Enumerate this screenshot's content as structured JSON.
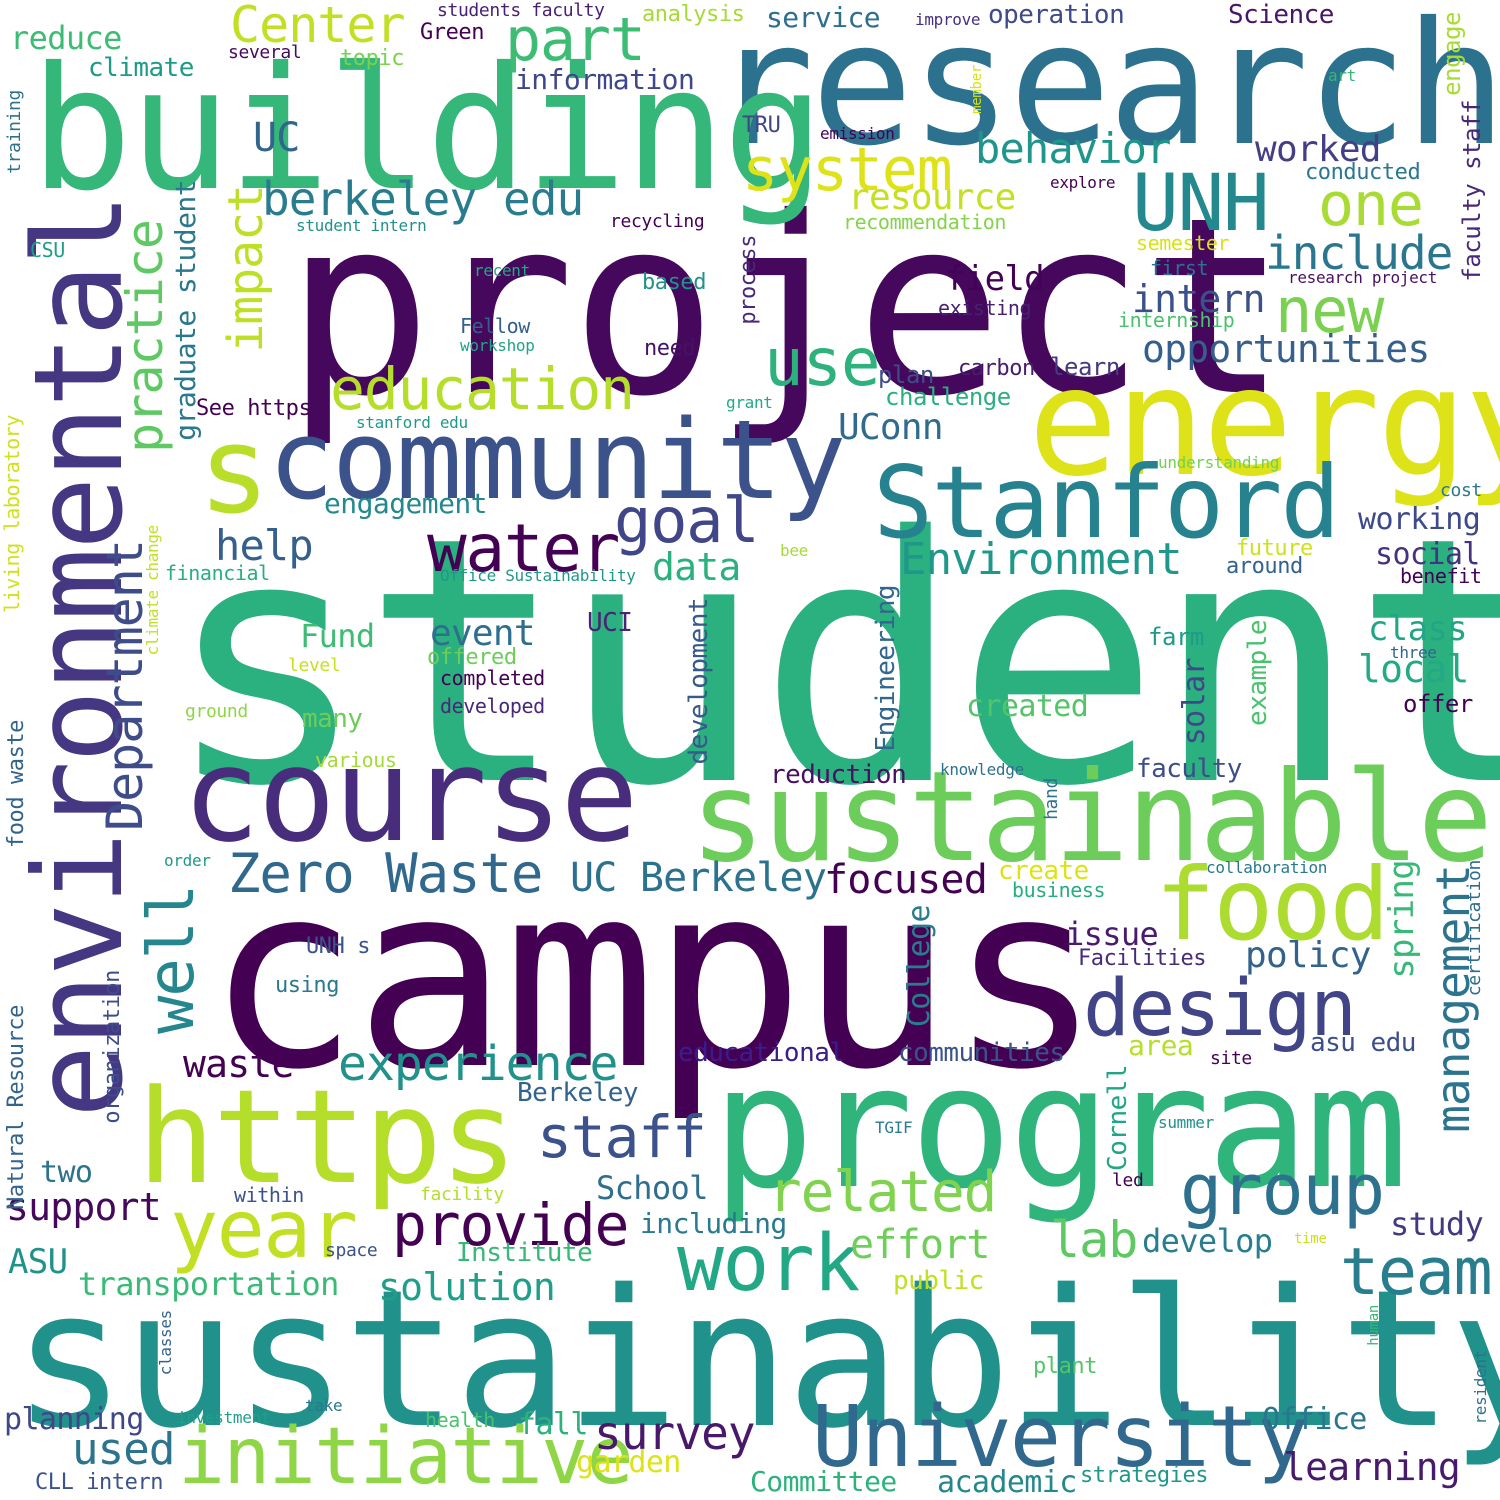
{
  "words": [
    {
      "text": "student",
      "color": "#2bb07f"
    },
    {
      "text": "campus",
      "color": "#440154"
    },
    {
      "text": "sustainability",
      "color": "#21918c"
    },
    {
      "text": "project",
      "color": "#46085c"
    },
    {
      "text": "research",
      "color": "#2c728e"
    },
    {
      "text": "building",
      "color": "#35b779"
    },
    {
      "text": "program",
      "color": "#2fb47c"
    },
    {
      "text": "environmental",
      "color": "#453781"
    },
    {
      "text": "energy",
      "color": "#dde318"
    },
    {
      "text": "sustainable",
      "color": "#6ccd5a"
    },
    {
      "text": "community",
      "color": "#3b528b"
    },
    {
      "text": "course",
      "color": "#472d7b"
    },
    {
      "text": "https",
      "color": "#b5de2b"
    },
    {
      "text": "Stanford",
      "color": "#26828e"
    },
    {
      "text": "University",
      "color": "#31688e"
    },
    {
      "text": "initiative",
      "color": "#8ed645"
    },
    {
      "text": "food",
      "color": "#addc30"
    },
    {
      "text": "design",
      "color": "#414487"
    },
    {
      "text": "s",
      "color": "#b8de29"
    },
    {
      "text": "year",
      "color": "#c2df23"
    },
    {
      "text": "work",
      "color": "#22a884"
    },
    {
      "text": "group",
      "color": "#2d718e"
    },
    {
      "text": "team",
      "color": "#287d8e"
    },
    {
      "text": "provide",
      "color": "#440154"
    },
    {
      "text": "UNH",
      "color": "#23898e"
    },
    {
      "text": "water",
      "color": "#440154"
    },
    {
      "text": "education",
      "color": "#b5de2b"
    },
    {
      "text": "system",
      "color": "#dde318"
    },
    {
      "text": "use",
      "color": "#2db27d"
    },
    {
      "text": "new",
      "color": "#7ad151"
    },
    {
      "text": "one",
      "color": "#a8db34"
    },
    {
      "text": "part",
      "color": "#3dbc74"
    },
    {
      "text": "Center",
      "color": "#c2df23"
    },
    {
      "text": "goal",
      "color": "#404688"
    },
    {
      "text": "management",
      "color": "#2c738e"
    },
    {
      "text": "well",
      "color": "#24868e"
    },
    {
      "text": "Department",
      "color": "#3e4c8a"
    },
    {
      "text": "practice",
      "color": "#5ec962"
    },
    {
      "text": "impact",
      "color": "#bddf26"
    },
    {
      "text": "staff",
      "color": "#3b528b"
    },
    {
      "text": "related",
      "color": "#7fd34e"
    },
    {
      "text": "experience",
      "color": "#21918c"
    },
    {
      "text": "Zero Waste",
      "color": "#31688e"
    },
    {
      "text": "berkeley edu",
      "color": "#287c8e"
    },
    {
      "text": "Environment",
      "color": "#1f988b"
    },
    {
      "text": "behavior",
      "color": "#1f968b"
    },
    {
      "text": "include",
      "color": "#2a768e"
    },
    {
      "text": "opportunities",
      "color": "#355f8d"
    },
    {
      "text": "intern",
      "color": "#3b518b"
    },
    {
      "text": "help",
      "color": "#355f8d"
    },
    {
      "text": "UC Berkeley",
      "color": "#2c728e"
    },
    {
      "text": "focused",
      "color": "#440154"
    },
    {
      "text": "survey",
      "color": "#48186a"
    },
    {
      "text": "used",
      "color": "#2c738e"
    },
    {
      "text": "learning",
      "color": "#481a6c"
    },
    {
      "text": "lab",
      "color": "#5ec962"
    },
    {
      "text": "effort",
      "color": "#6ece58"
    },
    {
      "text": "solution",
      "color": "#1f9e89"
    },
    {
      "text": "transportation",
      "color": "#3aba76"
    },
    {
      "text": "support",
      "color": "#46085c"
    },
    {
      "text": "waste",
      "color": "#440154"
    },
    {
      "text": "graduate student",
      "color": "#2a788e"
    },
    {
      "text": "resource",
      "color": "#c5e021"
    },
    {
      "text": "UConn",
      "color": "#2f6b8e"
    },
    {
      "text": "data",
      "color": "#2bb07f"
    },
    {
      "text": "event",
      "color": "#2d708e"
    },
    {
      "text": "Fund",
      "color": "#3fbc73"
    },
    {
      "text": "UC",
      "color": "#32658e"
    },
    {
      "text": "policy",
      "color": "#33638d"
    },
    {
      "text": "issue",
      "color": "#481b6d"
    },
    {
      "text": "local",
      "color": "#23a983"
    },
    {
      "text": "class",
      "color": "#21a685"
    },
    {
      "text": "social",
      "color": "#46337f"
    },
    {
      "text": "working",
      "color": "#3e4989"
    },
    {
      "text": "field",
      "color": "#440256"
    },
    {
      "text": "worked",
      "color": "#433e85"
    },
    {
      "text": "engagement",
      "color": "#23898e"
    },
    {
      "text": "spring",
      "color": "#38b977"
    },
    {
      "text": "College",
      "color": "#2a7b8e"
    },
    {
      "text": "study",
      "color": "#453882"
    },
    {
      "text": "develop",
      "color": "#287d8e"
    },
    {
      "text": "School",
      "color": "#2e6e8e"
    },
    {
      "text": "academic",
      "color": "#24878e"
    },
    {
      "text": "Committee",
      "color": "#2db27d"
    },
    {
      "text": "garden",
      "color": "#dde318"
    },
    {
      "text": "Office",
      "color": "#2a768e"
    },
    {
      "text": "fall",
      "color": "#2db27d"
    },
    {
      "text": "planning",
      "color": "#404688"
    },
    {
      "text": "two",
      "color": "#2c738e"
    },
    {
      "text": "ASU",
      "color": "#20928c"
    },
    {
      "text": "Institute",
      "color": "#37b878"
    },
    {
      "text": "including",
      "color": "#297a8e"
    },
    {
      "text": "educational",
      "color": "#3b1c8c"
    },
    {
      "text": "communities",
      "color": "#3b528b"
    },
    {
      "text": "asu edu",
      "color": "#3c4f8a"
    },
    {
      "text": "area",
      "color": "#b8de29"
    },
    {
      "text": "Berkeley",
      "color": "#33638d"
    },
    {
      "text": "Cornell",
      "color": "#21a685"
    },
    {
      "text": "Engineering",
      "color": "#31678e"
    },
    {
      "text": "development",
      "color": "#38598c"
    },
    {
      "text": "solar",
      "color": "#3f4889"
    },
    {
      "text": "example",
      "color": "#4ac16d"
    },
    {
      "text": "farm",
      "color": "#1f9a8a"
    },
    {
      "text": "created",
      "color": "#52c569"
    },
    {
      "text": "reduction",
      "color": "#471063"
    },
    {
      "text": "faculty",
      "color": "#3d4d8a"
    },
    {
      "text": "create",
      "color": "#dde318"
    },
    {
      "text": "many",
      "color": "#6ccd5a"
    },
    {
      "text": "UCI",
      "color": "#482475"
    },
    {
      "text": "offered",
      "color": "#6ccd5a"
    },
    {
      "text": "completed",
      "color": "#440154"
    },
    {
      "text": "developed",
      "color": "#482878"
    },
    {
      "text": "future",
      "color": "#d0e11c"
    },
    {
      "text": "around",
      "color": "#33638d"
    },
    {
      "text": "benefit",
      "color": "#440154"
    },
    {
      "text": "offer",
      "color": "#440154"
    },
    {
      "text": "cost",
      "color": "#2a788e"
    },
    {
      "text": "Facilities",
      "color": "#472c7a"
    },
    {
      "text": "UNH s",
      "color": "#3b528b"
    },
    {
      "text": "using",
      "color": "#2a788e"
    },
    {
      "text": "plan",
      "color": "#3d4e8a"
    },
    {
      "text": "carbon",
      "color": "#481c6e"
    },
    {
      "text": "learn",
      "color": "#443a83"
    },
    {
      "text": "challenge",
      "color": "#2ab07f"
    },
    {
      "text": "existing",
      "color": "#482071"
    },
    {
      "text": "internship",
      "color": "#4ac16d"
    },
    {
      "text": "first",
      "color": "#2c728e"
    },
    {
      "text": "based",
      "color": "#20928c"
    },
    {
      "text": "need",
      "color": "#471164"
    },
    {
      "text": "process",
      "color": "#482979"
    },
    {
      "text": "recommendation",
      "color": "#84d44b"
    },
    {
      "text": "semester",
      "color": "#d8e219"
    },
    {
      "text": "conducted",
      "color": "#2a788e"
    },
    {
      "text": "faculty staff",
      "color": "#482878"
    },
    {
      "text": "engage",
      "color": "#a8db34"
    },
    {
      "text": "research project",
      "color": "#471063"
    },
    {
      "text": "TRU",
      "color": "#3f4788"
    },
    {
      "text": "emission",
      "color": "#440154"
    },
    {
      "text": "explore",
      "color": "#440154"
    },
    {
      "text": "art",
      "color": "#35b779"
    },
    {
      "text": "member",
      "color": "#d2e21b"
    },
    {
      "text": "improve",
      "color": "#472f7d"
    },
    {
      "text": "operation",
      "color": "#3e4a89"
    },
    {
      "text": "service",
      "color": "#2e6e8e"
    },
    {
      "text": "Science",
      "color": "#481567"
    },
    {
      "text": "analysis",
      "color": "#a5db36"
    },
    {
      "text": "students faculty",
      "color": "#482173"
    },
    {
      "text": "information",
      "color": "#3f4788"
    },
    {
      "text": "topic",
      "color": "#7ad151"
    },
    {
      "text": "Green",
      "color": "#440154"
    },
    {
      "text": "several",
      "color": "#460a5d"
    },
    {
      "text": "climate",
      "color": "#1f9a8a"
    },
    {
      "text": "reduce",
      "color": "#3dbc74"
    },
    {
      "text": "training",
      "color": "#2c728e"
    },
    {
      "text": "CSU",
      "color": "#1f9e89"
    },
    {
      "text": "student intern",
      "color": "#21918c"
    },
    {
      "text": "recycling",
      "color": "#440154"
    },
    {
      "text": "recent",
      "color": "#22a884"
    },
    {
      "text": "Fellow",
      "color": "#34608d"
    },
    {
      "text": "workshop",
      "color": "#20a386"
    },
    {
      "text": "See https",
      "color": "#440154"
    },
    {
      "text": "stanford edu",
      "color": "#1f9a8a"
    },
    {
      "text": "grant",
      "color": "#22a884"
    },
    {
      "text": "living laboratory",
      "color": "#d0e11c"
    },
    {
      "text": "climate change",
      "color": "#c2df23"
    },
    {
      "text": "understanding",
      "color": "#73d056"
    },
    {
      "text": "financial",
      "color": "#29af7f"
    },
    {
      "text": "Office Sustainability",
      "color": "#1f988b"
    },
    {
      "text": "bee",
      "color": "#a5db36"
    },
    {
      "text": "level",
      "color": "#c8e020"
    },
    {
      "text": "ground",
      "color": "#8ed645"
    },
    {
      "text": "various",
      "color": "#a5db36"
    },
    {
      "text": "food waste",
      "color": "#33638d"
    },
    {
      "text": "order",
      "color": "#1f988b"
    },
    {
      "text": "knowledge",
      "color": "#2d718e"
    },
    {
      "text": "hand",
      "color": "#2c738e"
    },
    {
      "text": "business",
      "color": "#26ad81"
    },
    {
      "text": "collaboration",
      "color": "#29798e"
    },
    {
      "text": "certification",
      "color": "#2f6c8e"
    },
    {
      "text": "three",
      "color": "#33638d"
    },
    {
      "text": "Natural Resource",
      "color": "#33638d"
    },
    {
      "text": "organization",
      "color": "#3d4d8a"
    },
    {
      "text": "within",
      "color": "#3b528b"
    },
    {
      "text": "facility",
      "color": "#b5de2b"
    },
    {
      "text": "site",
      "color": "#440154"
    },
    {
      "text": "TGIF",
      "color": "#287d8e"
    },
    {
      "text": "summer",
      "color": "#20928c"
    },
    {
      "text": "led",
      "color": "#440154"
    },
    {
      "text": "space",
      "color": "#3b528b"
    },
    {
      "text": "public",
      "color": "#c2df23"
    },
    {
      "text": "time",
      "color": "#c8e020"
    },
    {
      "text": "human",
      "color": "#35b779"
    },
    {
      "text": "resident",
      "color": "#2c728e"
    },
    {
      "text": "classes",
      "color": "#33638d"
    },
    {
      "text": "plant",
      "color": "#52c569"
    },
    {
      "text": "investment",
      "color": "#1fa088"
    },
    {
      "text": "take",
      "color": "#2a788e"
    },
    {
      "text": "health",
      "color": "#4ac16d"
    },
    {
      "text": "strategies",
      "color": "#1f988b"
    },
    {
      "text": "CLL intern",
      "color": "#3b528b"
    }
  ]
}
